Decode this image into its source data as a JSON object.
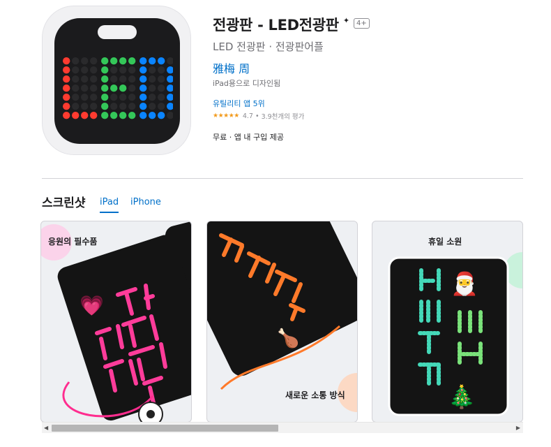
{
  "app": {
    "title": "전광판 - LED전광판",
    "title_mark": "✦",
    "age_rating": "4+",
    "subtitle": "LED 전광판 · 전광판어플",
    "developer": "雅梅 周",
    "designed_for": "iPad용으로 디자인됨",
    "category_rank": "유틸리티 앱 5위",
    "rating": {
      "stars_text": "★★★★★",
      "score": "4.7",
      "separator": "•",
      "count_text": "3.9천개의 평가",
      "star_value": 4.7
    },
    "price": "무료 · 앱 내 구입 제공",
    "icon": {
      "text": "LED",
      "colors": [
        "#ff3b30",
        "#34c759",
        "#0a84ff"
      ]
    }
  },
  "screenshots": {
    "heading": "스크린샷",
    "tabs": [
      {
        "label": "iPad",
        "active": true
      },
      {
        "label": "iPhone",
        "active": false
      }
    ],
    "items": [
      {
        "caption": "응원의 필수품",
        "board_text": "사랑해요 손흥민"
      },
      {
        "caption": "새로운 소통 방식",
        "board_text": "모셔줘요?"
      },
      {
        "caption": "휴일 소원",
        "board_text": "메리 크리스마스"
      }
    ]
  },
  "scrollbar": {
    "left_arrow": "◀",
    "right_arrow": "▶"
  }
}
